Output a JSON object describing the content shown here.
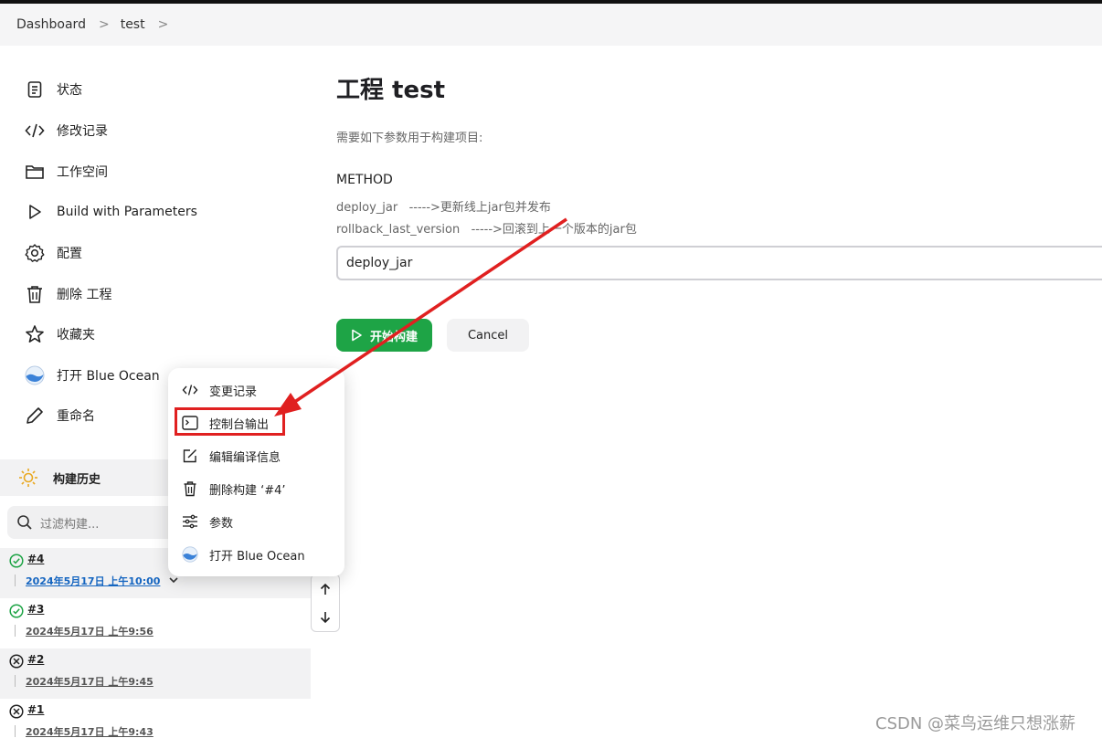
{
  "breadcrumb": {
    "items": [
      "Dashboard",
      "test"
    ],
    "separator": ">"
  },
  "sidebar": {
    "items": [
      {
        "label": "状态",
        "icon": "document-icon"
      },
      {
        "label": "修改记录",
        "icon": "code-icon"
      },
      {
        "label": "工作空间",
        "icon": "folder-icon"
      },
      {
        "label": "Build with Parameters",
        "icon": "play-icon"
      },
      {
        "label": "配置",
        "icon": "gear-icon"
      },
      {
        "label": "删除 工程",
        "icon": "trash-icon"
      },
      {
        "label": "收藏夹",
        "icon": "star-icon"
      },
      {
        "label": "打开 Blue Ocean",
        "icon": "blue-ocean-icon"
      },
      {
        "label": "重命名",
        "icon": "pencil-icon"
      }
    ]
  },
  "build_history": {
    "title": "构建历史",
    "filter_placeholder": "过滤构建...",
    "builds": [
      {
        "number": "#4",
        "date": "2024年5月17日 上午10:00",
        "status": "success"
      },
      {
        "number": "#3",
        "date": "2024年5月17日 上午9:56",
        "status": "success"
      },
      {
        "number": "#2",
        "date": "2024年5月17日 上午9:45",
        "status": "failed"
      },
      {
        "number": "#1",
        "date": "2024年5月17日 上午9:43",
        "status": "failed"
      }
    ]
  },
  "main": {
    "title": "工程 test",
    "description": "需要如下参数用于构建项目:",
    "parameter": {
      "name": "METHOD",
      "desc_lines": [
        "deploy_jar   ----->更新线上jar包并发布",
        "rollback_last_version   ----->回滚到上一个版本的jar包"
      ],
      "selected_value": "deploy_jar"
    },
    "build_button": "开始构建",
    "cancel_button": "Cancel"
  },
  "context_menu": {
    "items": [
      {
        "label": "变更记录",
        "icon": "code-icon"
      },
      {
        "label": "控制台输出",
        "icon": "terminal-icon"
      },
      {
        "label": "编辑编译信息",
        "icon": "edit-icon"
      },
      {
        "label": "删除构建 ‘#4’",
        "icon": "trash-icon"
      },
      {
        "label": "参数",
        "icon": "sliders-icon"
      },
      {
        "label": "打开 Blue Ocean",
        "icon": "blue-ocean-icon"
      }
    ]
  },
  "colors": {
    "primary_green": "#1ea446",
    "link_blue": "#1565c0",
    "annotation_red": "#e02020"
  },
  "watermark": "CSDN @菜鸟运维只想涨薪"
}
